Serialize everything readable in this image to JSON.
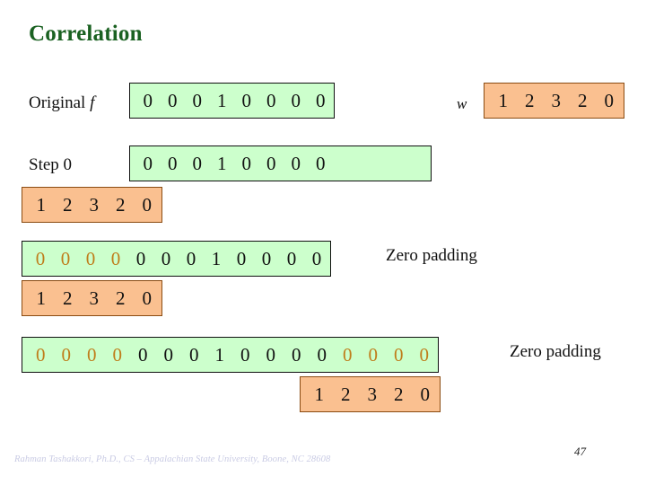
{
  "slide": {
    "title": "Correlation",
    "number": "47",
    "footer_credit": "Rahman Tashakkori, Ph.D., CS – Appalachian State University, Boone, NC 28608"
  },
  "colors": {
    "title": "#1a6121",
    "signal_fill": "#ccffcc",
    "signal_border": "#101010",
    "kernel_fill": "#fac090",
    "kernel_border": "#8a4b12",
    "padding_digit": "#bf7d1b",
    "digit": "#111111",
    "footer": "#c9cbe4"
  },
  "labels": {
    "original": "Original",
    "original_var": "f",
    "kernel_var": "w",
    "step0": "Step 0",
    "zero_padding": "Zero padding"
  },
  "rows": {
    "original": {
      "label": "Original",
      "label_italic": "f",
      "signal": [
        "0",
        "0",
        "0",
        "1",
        "0",
        "0",
        "0",
        "0"
      ],
      "signal_pad_flags": [
        false,
        false,
        false,
        false,
        false,
        false,
        false,
        false
      ]
    },
    "kernel_top": {
      "var": "w",
      "values": [
        "1",
        "2",
        "3",
        "2",
        "0"
      ]
    },
    "step0": {
      "label": "Step 0",
      "signal": [
        "0",
        "0",
        "0",
        "1",
        "0",
        "0",
        "0",
        "0"
      ],
      "signal_pad_flags": [
        false,
        false,
        false,
        false,
        false,
        false,
        false,
        false
      ],
      "signal_trailing_blank_cells": 4,
      "kernel": [
        "1",
        "2",
        "3",
        "2",
        "0"
      ]
    },
    "pad_left": {
      "signal": [
        "0",
        "0",
        "0",
        "0",
        "0",
        "0",
        "0",
        "1",
        "0",
        "0",
        "0",
        "0"
      ],
      "signal_pad_flags": [
        true,
        true,
        true,
        true,
        false,
        false,
        false,
        false,
        false,
        false,
        false,
        false
      ],
      "kernel": [
        "1",
        "2",
        "3",
        "2",
        "0"
      ],
      "note": "Zero padding"
    },
    "pad_both": {
      "signal": [
        "0",
        "0",
        "0",
        "0",
        "0",
        "0",
        "0",
        "1",
        "0",
        "0",
        "0",
        "0",
        "0",
        "0",
        "0",
        "0"
      ],
      "signal_pad_flags": [
        true,
        true,
        true,
        true,
        false,
        false,
        false,
        false,
        false,
        false,
        false,
        false,
        true,
        true,
        true,
        true
      ],
      "kernel": [
        "1",
        "2",
        "3",
        "2",
        "0"
      ],
      "note": "Zero padding"
    }
  }
}
